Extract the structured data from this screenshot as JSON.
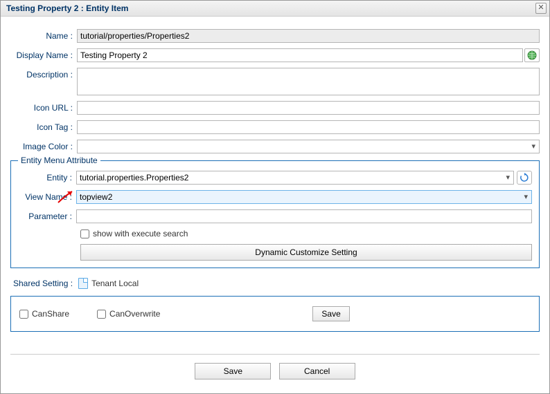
{
  "titlebar": {
    "text": "Testing Property 2 : Entity Item"
  },
  "labels": {
    "name": "Name :",
    "displayName": "Display Name :",
    "description": "Description :",
    "iconUrl": "Icon URL :",
    "iconTag": "Icon Tag :",
    "imageColor": "Image Color :"
  },
  "values": {
    "name": "tutorial/properties/Properties2",
    "displayName": "Testing Property 2",
    "description": "",
    "iconUrl": "",
    "iconTag": "",
    "imageColor": ""
  },
  "fieldset": {
    "legend": "Entity Menu Attribute",
    "labels": {
      "entity": "Entity :",
      "viewName": "View Name :",
      "parameter": "Parameter :"
    },
    "values": {
      "entity": "tutorial.properties.Properties2",
      "viewName": "topview2",
      "parameter": ""
    },
    "showExecSearch": "show with execute search",
    "dynButton": "Dynamic Customize Setting"
  },
  "shared": {
    "label": "Shared Setting :",
    "value": "Tenant Local"
  },
  "perm": {
    "canShare": "CanShare",
    "canOverwrite": "CanOverwrite",
    "save": "Save"
  },
  "footer": {
    "save": "Save",
    "cancel": "Cancel"
  }
}
